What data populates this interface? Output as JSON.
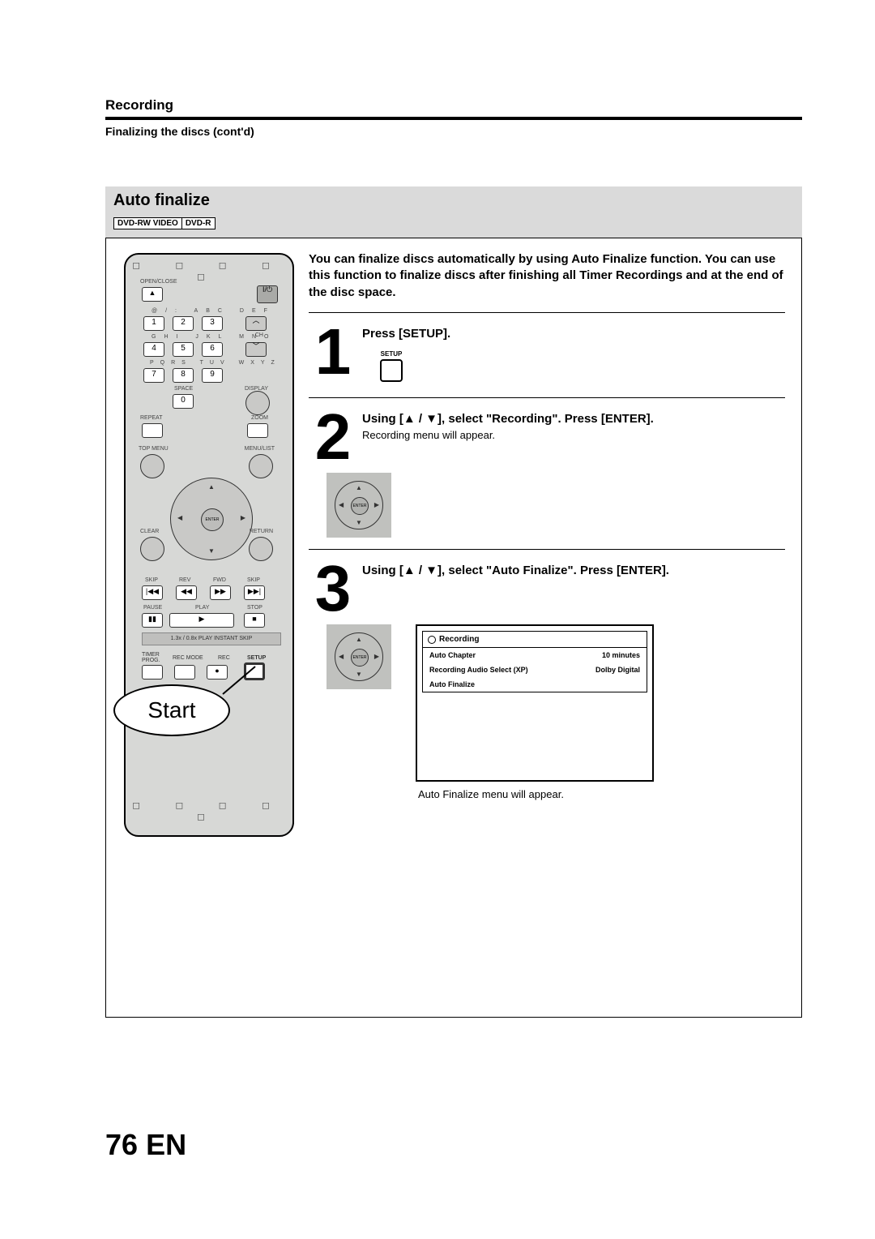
{
  "header": {
    "chapter": "Recording",
    "section": "Finalizing the discs (cont'd)"
  },
  "greyband": {
    "title": "Auto finalize",
    "badges": [
      "DVD-RW VIDEO",
      "DVD-R"
    ]
  },
  "intro": "You can finalize discs automatically by using Auto Finalize function. You can use this function to finalize discs after finishing all Timer Recordings and at the end of the disc space.",
  "steps": {
    "s1": {
      "num": "1",
      "title": "Press [SETUP].",
      "btn_label": "SETUP"
    },
    "s2": {
      "num": "2",
      "title": "Using [▲ / ▼], select \"Recording\". Press [ENTER].",
      "sub": "Recording menu will appear.",
      "enter": "ENTER"
    },
    "s3": {
      "num": "3",
      "title": "Using [▲ / ▼], select \"Auto Finalize\". Press [ENTER].",
      "enter": "ENTER",
      "after": "Auto Finalize menu will appear."
    }
  },
  "osd": {
    "title": "Recording",
    "rows": [
      {
        "label": "Auto Chapter",
        "value": "10 minutes"
      },
      {
        "label": "Recording Audio Select (XP)",
        "value": "Dolby Digital"
      },
      {
        "label": "Auto Finalize",
        "value": ""
      }
    ]
  },
  "remote": {
    "open_close": "OPEN/CLOSE",
    "power": "I/⏻",
    "abc_row": "@/:   ABC   DEF",
    "ghi_row": "GHI   JKL   MNO",
    "pqrs_row": "PQRS  TUV  WXYZ",
    "space": "SPACE",
    "display": "DISPLAY",
    "ch": "CH",
    "repeat": "REPEAT",
    "zoom": "ZOOM",
    "topmenu": "TOP MENU",
    "menulist": "MENU/LIST",
    "clear": "CLEAR",
    "return": "RETURN",
    "enter": "ENTER",
    "skip": "SKIP",
    "rev": "REV",
    "fwd": "FWD",
    "skip2": "SKIP",
    "pause": "PAUSE",
    "play": "PLAY",
    "stop": "STOP",
    "speed": "1.3x / 0.8x PLAY   INSTANT SKIP",
    "timer": "TIMER\nPROG.",
    "recmode": "REC MODE",
    "rec": "REC",
    "setup": "SETUP",
    "start_bubble": "Start",
    "keys": {
      "k1": "1",
      "k2": "2",
      "k3": "3",
      "k4": "4",
      "k5": "5",
      "k6": "6",
      "k7": "7",
      "k8": "8",
      "k9": "9",
      "k0": "0"
    }
  },
  "footer": {
    "page": "76",
    "lang": "EN"
  }
}
